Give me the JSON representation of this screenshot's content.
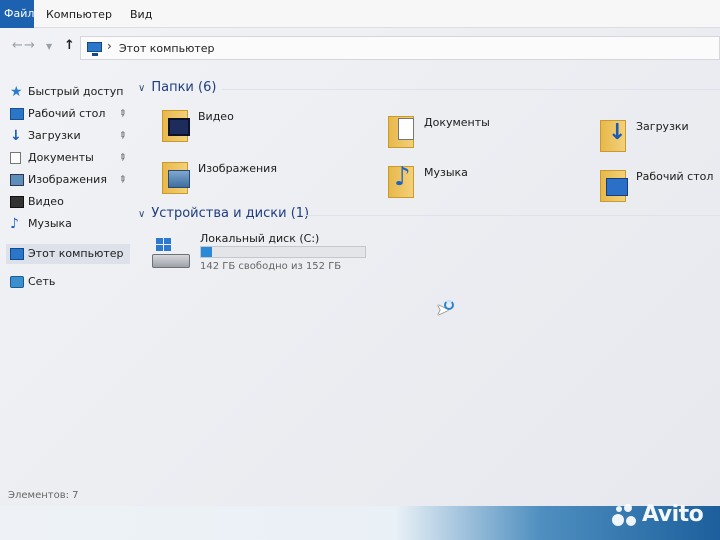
{
  "ribbon": {
    "file_tab": "Файл",
    "tabs": [
      "Компьютер",
      "Вид"
    ]
  },
  "address": {
    "path": "Этот компьютер",
    "icons": {
      "back": "arrow-left-icon",
      "forward": "arrow-right-icon",
      "recent": "chevron-down-icon",
      "up": "arrow-up-icon"
    }
  },
  "sidebar": {
    "items": [
      {
        "label": "Быстрый доступ",
        "icon": "star-icon",
        "pinned": false
      },
      {
        "label": "Рабочий стол",
        "icon": "desktop-icon",
        "pinned": true
      },
      {
        "label": "Загрузки",
        "icon": "download-icon",
        "pinned": true
      },
      {
        "label": "Документы",
        "icon": "documents-icon",
        "pinned": true
      },
      {
        "label": "Изображения",
        "icon": "pictures-icon",
        "pinned": true
      },
      {
        "label": "Видео",
        "icon": "video-icon",
        "pinned": false
      },
      {
        "label": "Музыка",
        "icon": "music-icon",
        "pinned": false
      },
      {
        "label": "Этот компьютер",
        "icon": "computer-icon",
        "pinned": false,
        "selected": true
      },
      {
        "label": "Сеть",
        "icon": "network-icon",
        "pinned": false
      }
    ]
  },
  "main": {
    "folders_header": "Папки (6)",
    "folders": [
      {
        "label": "Видео",
        "icon": "video-folder-icon"
      },
      {
        "label": "Документы",
        "icon": "documents-folder-icon"
      },
      {
        "label": "Загрузки",
        "icon": "downloads-folder-icon"
      },
      {
        "label": "Изображения",
        "icon": "pictures-folder-icon"
      },
      {
        "label": "Музыка",
        "icon": "music-folder-icon"
      },
      {
        "label": "Рабочий стол",
        "icon": "desktop-folder-icon"
      }
    ],
    "drives_header": "Устройства и диски (1)",
    "drives": [
      {
        "label": "Локальный диск (C:)",
        "free_text": "142 ГБ свободно из 152 ГБ",
        "used_fraction": 0.066,
        "icon": "local-disk-icon"
      }
    ]
  },
  "status": {
    "items_text": "Элементов: 7"
  },
  "watermark": {
    "text": "Avito"
  },
  "colors": {
    "accent": "#1d62b0",
    "header_text": "#1e3d80",
    "drive_fill": "#2b8ad8"
  }
}
